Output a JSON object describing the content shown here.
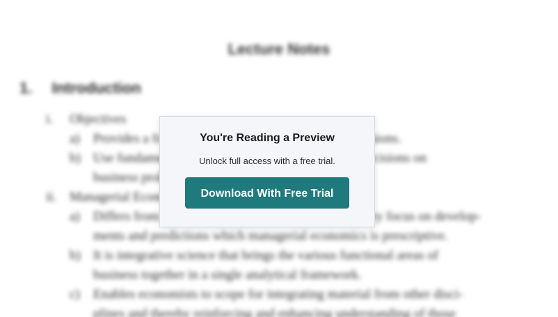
{
  "document": {
    "title": "Lecture Notes",
    "heading": {
      "number": "1.",
      "text": "Introduction"
    },
    "lines": [
      {
        "bullet": "i.",
        "text": "Objectives"
      },
      {
        "bullet": "a)",
        "text": "Provides a framework for managerial economic decisions."
      },
      {
        "bullet": "b)",
        "text": "Use fundamentals of economics to aid managerial decisions on"
      },
      {
        "bullet": "",
        "text": "business problems."
      },
      {
        "bullet": "ii.",
        "text": "Managerial Economics"
      },
      {
        "bullet": "a)",
        "text": "Differs from traditional economics because its primary focus on develop-"
      },
      {
        "bullet": "",
        "text": "ments and predictions which managerial economics is prescriptive."
      },
      {
        "bullet": "b)",
        "text": "It is integrative science that brings the various functional areas of"
      },
      {
        "bullet": "",
        "text": "business together in a single analytical framework."
      },
      {
        "bullet": "c)",
        "text": "Enables economists to scope for integrating material from other disci-"
      },
      {
        "bullet": "",
        "text": "plines and thereby reinforcing and enhancing understanding of those"
      }
    ]
  },
  "preview": {
    "title": "You're Reading a Preview",
    "subtitle": "Unlock full access with a free trial.",
    "button_label": "Download With Free Trial",
    "button_color": "#1f7a7e"
  }
}
